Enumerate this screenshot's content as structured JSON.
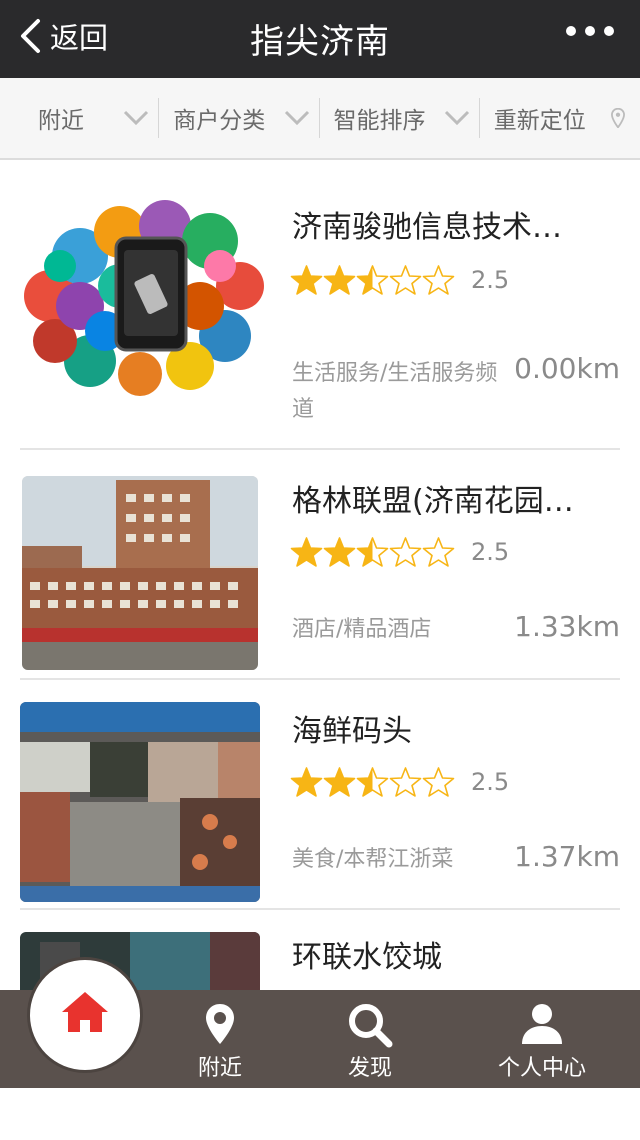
{
  "header": {
    "back_label": "返回",
    "title": "指尖济南"
  },
  "filters": [
    {
      "label": "附近"
    },
    {
      "label": "商户分类"
    },
    {
      "label": "智能排序"
    },
    {
      "label": "重新定位"
    }
  ],
  "listings": [
    {
      "name": "济南骏驰信息技术…",
      "rating": 2.5,
      "score": "2.5",
      "category": "生活服务/生活服务频道",
      "distance": "0.00km"
    },
    {
      "name": "格林联盟(济南花园…",
      "rating": 2.5,
      "score": "2.5",
      "category": "酒店/精品酒店",
      "distance": "1.33km"
    },
    {
      "name": "海鲜码头",
      "rating": 2.5,
      "score": "2.5",
      "category": "美食/本帮江浙菜",
      "distance": "1.37km"
    },
    {
      "name": "环联水饺城"
    }
  ],
  "tabbar": {
    "nearby": "附近",
    "discover": "发现",
    "profile": "个人中心",
    "active_color": "#e8332e"
  },
  "colors": {
    "star": "#f7b515",
    "header": "#2a2a2c",
    "tabbar": "#5a514d"
  }
}
